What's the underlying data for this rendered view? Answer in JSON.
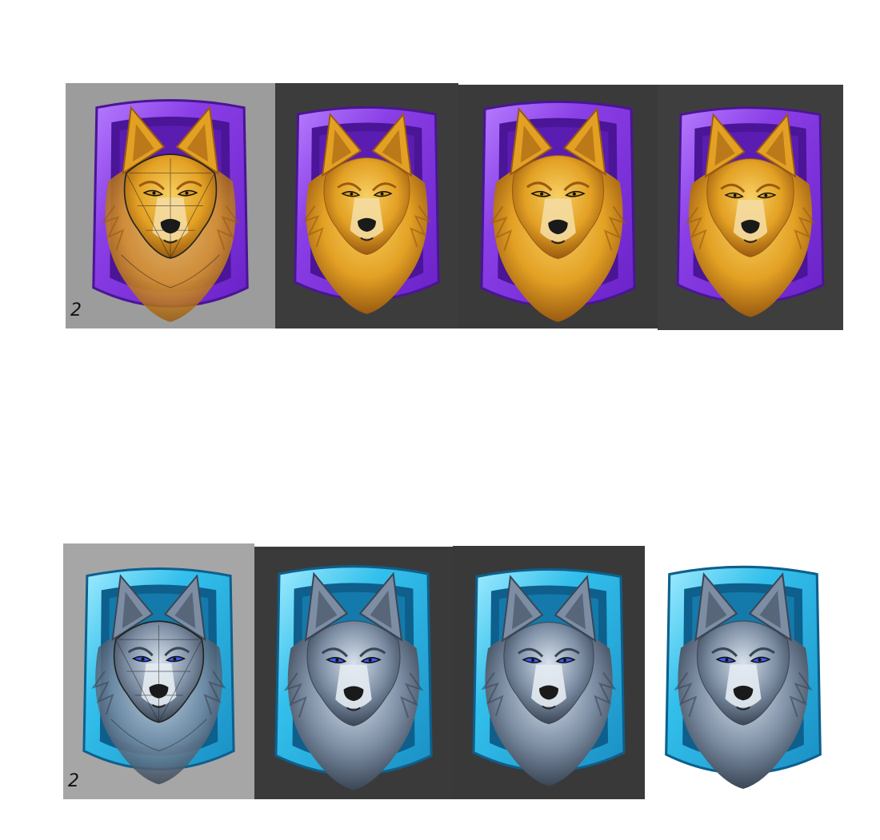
{
  "rows": [
    {
      "name": "gold-wolf-row",
      "frame": {
        "outer": "#6a22c8",
        "mid": "#8a3ee6",
        "inner": "#4a1596",
        "hl": "#b67dff"
      },
      "fur": {
        "main": "#e3a124",
        "light": "#f7d063",
        "dark": "#9a5a10",
        "muzzle": "#f4dca2"
      },
      "eye": "#e0a020",
      "cards": [
        {
          "stage": "sketch",
          "bg": "#9c9c9c",
          "label": "2"
        },
        {
          "stage": "render-1",
          "bg": "#3c3c3c",
          "label": ""
        },
        {
          "stage": "render-2",
          "bg": "#3a3a3a",
          "label": ""
        },
        {
          "stage": "render-3",
          "bg": "#3e3e3e",
          "label": ""
        }
      ]
    },
    {
      "name": "ice-wolf-row",
      "frame": {
        "outer": "#1a8fc4",
        "mid": "#33c0ec",
        "inner": "#0e5f8c",
        "hl": "#a2ecff"
      },
      "fur": {
        "main": "#7d8ea4",
        "light": "#d7e1ec",
        "dark": "#3a4656",
        "muzzle": "#e4ebf2"
      },
      "eye": "#3a5cff",
      "cards": [
        {
          "stage": "sketch",
          "bg": "#a6a6a6",
          "label": "2"
        },
        {
          "stage": "render-1",
          "bg": "#3a3a3a",
          "label": ""
        },
        {
          "stage": "render-2",
          "bg": "#393939",
          "label": ""
        },
        {
          "stage": "render-3",
          "bg": "#ffffff",
          "label": ""
        }
      ]
    }
  ]
}
